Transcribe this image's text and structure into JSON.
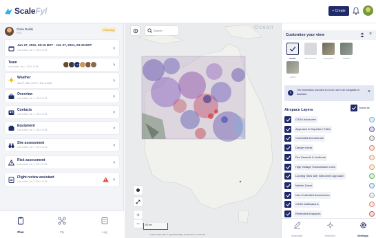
{
  "app": {
    "logo_main": "Scale",
    "logo_accent": "Fyl",
    "create_label": "+ Create"
  },
  "pilot": {
    "name": "Clara Dolski",
    "role": "Pilot",
    "status": "Planning"
  },
  "cards": {
    "datetime": {
      "title": "Jun 27, 2021, 09:15 BST - Jun 27, 2021, 09:15 BST",
      "sub": "Last edited Jun 1, 2021 10:58"
    },
    "team": {
      "title": "Team",
      "sub": "Last edited Jun 1, 2021 10:58",
      "extra": "+2"
    },
    "weather": {
      "title": "Weather",
      "values": "Jun 27, 2021 •  22°C  •  1%  •  6.2m/s"
    },
    "overview": {
      "title": "Overview",
      "sub": "Last edited Jun 1, 2021 10:58"
    },
    "contacts": {
      "title": "Contacts",
      "sub": "Last edited Jun 1, 2021 10:58"
    },
    "equipment": {
      "title": "Equipment",
      "sub": "Last edited Jun 1, 2021 10:58"
    },
    "site": {
      "title": "Site assessment",
      "sub": "Last edited Jun 1, 2021 10:58"
    },
    "risk": {
      "title": "Risk assessment",
      "sub": "Last edited Jun 1, 2021 10:58"
    },
    "review": {
      "title": "Flight review assistant",
      "sub": "Last edited Jun 1, 2021 10:58"
    }
  },
  "bottom_nav": [
    {
      "label": "Plan"
    },
    {
      "label": "Fly"
    },
    {
      "label": "Log"
    }
  ],
  "map": {
    "search_placeholder": "Search",
    "ocean_label": "Ocean",
    "scale_label": "200 km",
    "attribution": "Leaflet | Map data © OpenStreetMap contributors, CC-BY-SA"
  },
  "customise": {
    "title": "Customise your view",
    "styles": [
      {
        "label": "Streets",
        "color": "#eef0f3"
      },
      {
        "label": "Monochrome",
        "color": "#d7d9dd"
      },
      {
        "label": "Topographic",
        "color": "#8d8a7c"
      },
      {
        "label": "Satellite",
        "color": "#7f8a7a"
      },
      {
        "label": "Hybrid",
        "color": "#9c9c94"
      }
    ],
    "info_text": "The information provided is not for use in air navigation in Australia"
  },
  "airspace": {
    "title": "Airspace Layers",
    "select_all": "Select all",
    "layers": [
      {
        "name": "CASA Advisories",
        "color": "#6ab8d8"
      },
      {
        "name": "Approach & Departure Paths",
        "color": "#6a4fc0"
      },
      {
        "name": "Controlled Aerodromes",
        "color": "#8e8e8e"
      },
      {
        "name": "Danger Areas",
        "color": "#e87c6a"
      },
      {
        "name": "Fire Hazards & Incidents",
        "color": "#e89a6a"
      },
      {
        "name": "High Voltage Transmission Lines",
        "color": "#e8a06a"
      },
      {
        "name": "Landing Sites with Instrument Approach",
        "color": "#5fb85f"
      },
      {
        "name": "Marine Zones",
        "color": "#6a9ad8"
      },
      {
        "name": "Non-Controlled Aerodromes",
        "color": "#aaaaaa"
      },
      {
        "name": "CASA Notifications",
        "color": "#d88a6a"
      },
      {
        "name": "Restricted Airspaces",
        "color": "#d05a5a"
      }
    ]
  },
  "right_nav": [
    {
      "label": "Annotate"
    },
    {
      "label": "Selected"
    },
    {
      "label": "Settings"
    }
  ]
}
